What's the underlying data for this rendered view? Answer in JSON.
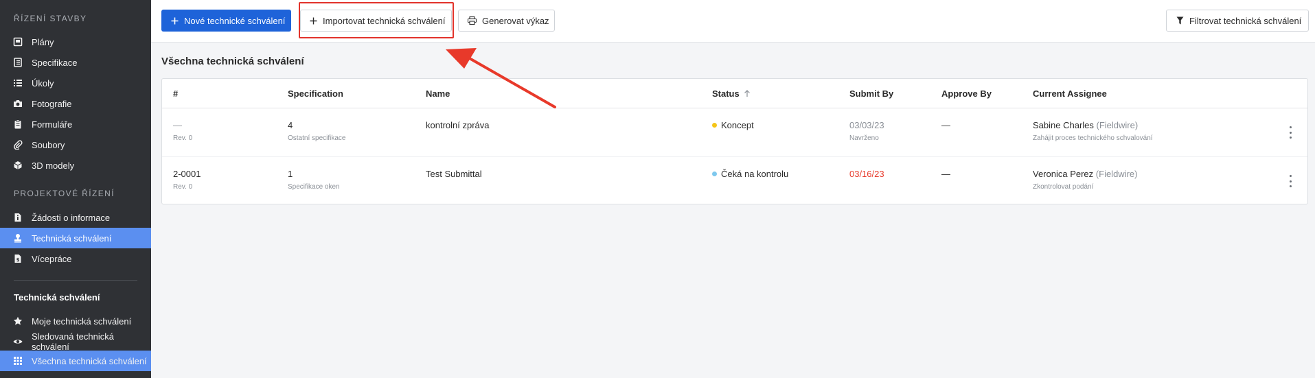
{
  "sidebar": {
    "section1": "ŘÍZENÍ STAVBY",
    "section1_items": [
      {
        "label": "Plány",
        "icon": "book-icon"
      },
      {
        "label": "Specifikace",
        "icon": "notebook-icon"
      },
      {
        "label": "Úkoly",
        "icon": "list-icon"
      },
      {
        "label": "Fotografie",
        "icon": "camera-icon"
      },
      {
        "label": "Formuláře",
        "icon": "clipboard-icon"
      },
      {
        "label": "Soubory",
        "icon": "paperclip-icon"
      },
      {
        "label": "3D modely",
        "icon": "cube-icon"
      }
    ],
    "section2": "PROJEKTOVÉ ŘÍZENÍ",
    "section2_items": [
      {
        "label": "Žádosti o informace",
        "icon": "info-doc-icon"
      },
      {
        "label": "Technická schválení",
        "icon": "stamp-icon"
      },
      {
        "label": "Vícepráce",
        "icon": "money-doc-icon"
      }
    ],
    "section3": "Technická schválení",
    "section3_items": [
      {
        "label": "Moje technická schválení",
        "icon": "star-icon"
      },
      {
        "label": "Sledovaná technická schválení",
        "icon": "eye-icon"
      },
      {
        "label": "Všechna technická schválení",
        "icon": "grid-icon"
      }
    ]
  },
  "toolbar": {
    "new_label": "Nové technické schválení",
    "import_label": "Importovat technická schválení",
    "report_label": "Generovat výkaz",
    "filter_label": "Filtrovat technická schválení"
  },
  "page": {
    "title": "Všechna technická schválení"
  },
  "table": {
    "headers": [
      "#",
      "Specification",
      "Name",
      "Status",
      "Submit By",
      "Approve By",
      "Current Assignee"
    ],
    "rows": [
      {
        "number": "—",
        "rev": "Rev. 0",
        "spec": "4",
        "spec_sub": "Ostatní specifikace",
        "name": "kontrolní zpráva",
        "status": "Koncept",
        "status_color": "#f5c518",
        "submit_by": "03/03/23",
        "submit_sub": "Navrženo",
        "approve_by": "—",
        "assignee": "Sabine Charles",
        "assignee_org": "(Fieldwire)",
        "assignee_sub": "Zahájit proces technického schvalování"
      },
      {
        "number": "2-0001",
        "rev": "Rev. 0",
        "spec": "1",
        "spec_sub": "Specifikace oken",
        "name": "Test Submittal",
        "status": "Čeká na kontrolu",
        "status_color": "#7ec8ee",
        "submit_by": "03/16/23",
        "submit_sub": "",
        "approve_by": "—",
        "assignee": "Veronica Perez",
        "assignee_org": "(Fieldwire)",
        "assignee_sub": "Zkontrolovat podání"
      }
    ]
  },
  "colors": {
    "accent": "#1e63d9",
    "active_nav": "#5b8ff0",
    "overdue": "#e8392a",
    "annotation": "#e2332b"
  }
}
